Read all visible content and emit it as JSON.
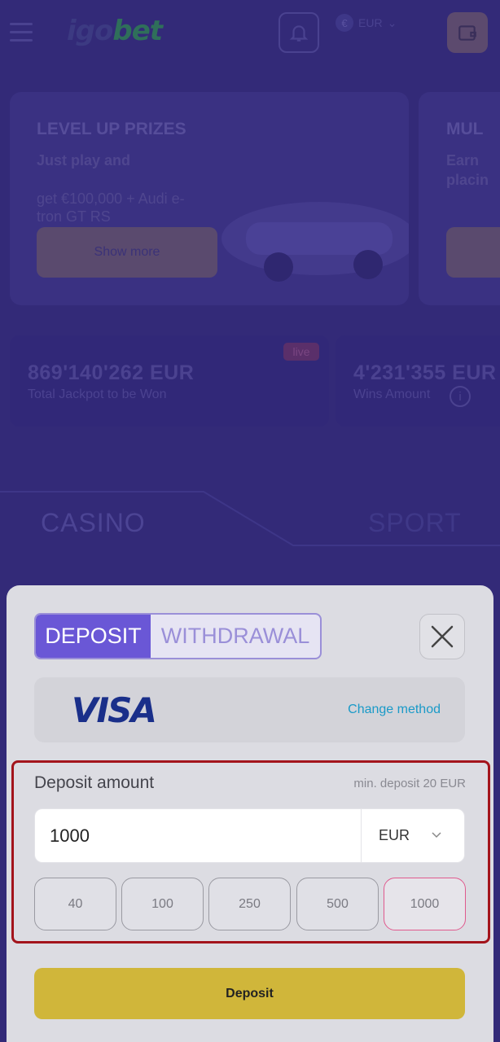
{
  "header": {
    "logo_prefix": "igo",
    "logo_suffix": "bet",
    "currency": "EUR"
  },
  "promos": [
    {
      "title": "LEVEL UP PRIZES",
      "subtitle": "Just play and",
      "text": "get €100,000 + Audi e-tron GT RS",
      "button": "Show more"
    },
    {
      "title": "MUL",
      "subtitle": "Earn",
      "text": "placin"
    }
  ],
  "stats": [
    {
      "value": "869'140'262 EUR",
      "label": "Total Jackpot to be Won",
      "badge": "live"
    },
    {
      "value": "4'231'355 EUR",
      "label": "Wins Amount"
    }
  ],
  "nav_tabs": {
    "casino": "CASINO",
    "sport": "SPORT"
  },
  "modal": {
    "tab_deposit": "DEPOSIT",
    "tab_withdrawal": "WITHDRAWAL",
    "method_logo": "VISA",
    "change_method": "Change method",
    "amount_label": "Deposit amount",
    "min_deposit": "min. deposit 20 EUR",
    "amount_value": "1000",
    "currency": "EUR",
    "quick_amounts": [
      "40",
      "100",
      "250",
      "500",
      "1000"
    ],
    "selected_quick_amount": "1000",
    "submit": "Deposit"
  },
  "colors": {
    "accent": "#6a57d6",
    "cta": "#d0b63a",
    "highlight_border": "#a3141c",
    "selected_chip": "#e05a8e"
  }
}
